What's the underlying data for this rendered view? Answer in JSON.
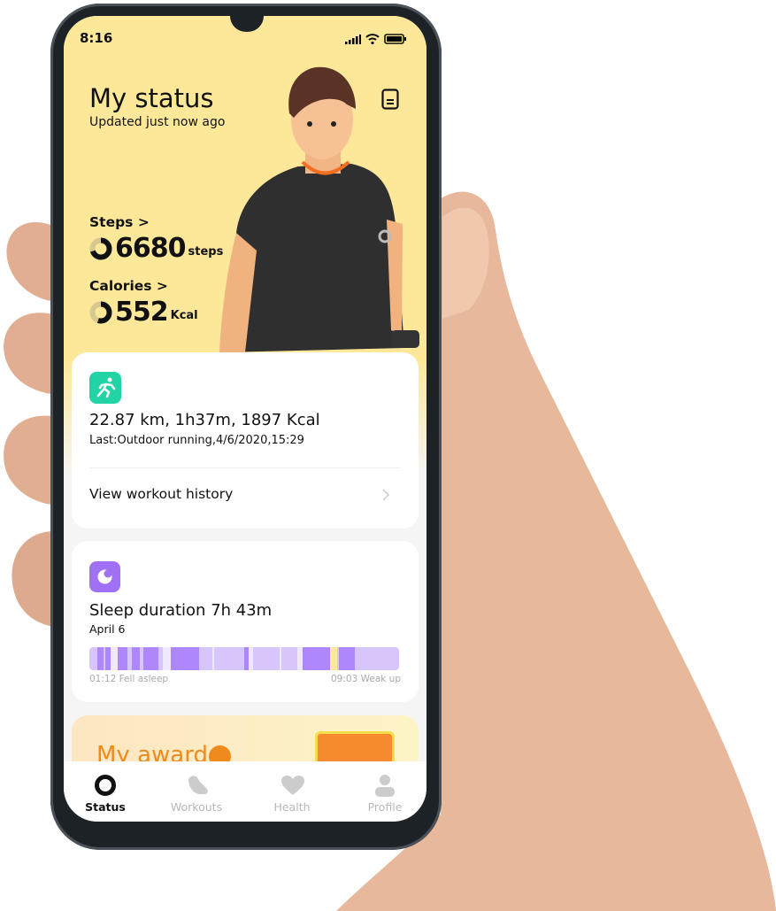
{
  "status_bar": {
    "time": "8:16"
  },
  "header": {
    "title": "My status",
    "subtitle": "Updated just now ago",
    "icon": "document-icon"
  },
  "steps": {
    "label": "Steps",
    "chevron": ">",
    "value": "6680",
    "unit": "steps",
    "progress": 0.7
  },
  "calories": {
    "label": "Calories",
    "chevron": ">",
    "value": "552",
    "unit": "Kcal",
    "progress": 0.55
  },
  "workout_card": {
    "icon": "running-icon",
    "icon_color": "#22d3a6",
    "summary": "22.87 km, 1h37m, 1897 Kcal",
    "last": "Last:Outdoor running,4/6/2020,15:29",
    "history_link": "View workout history"
  },
  "sleep_card": {
    "icon": "moon-icon",
    "icon_color": "#a071f5",
    "title": "Sleep duration 7h 43m",
    "date": "April 6",
    "start_label": "01:12 Fell asleep",
    "end_label": "09:03 Weak up",
    "colors": {
      "deep": "#ad87fb",
      "light": "#d6c6fc",
      "awake": "#efe8fe",
      "rem": "#fde99a"
    },
    "stages": [
      [
        "light",
        27
      ],
      [
        "deep",
        21
      ],
      [
        "light",
        7
      ],
      [
        "deep",
        17
      ],
      [
        "awake",
        23
      ],
      [
        "deep",
        35
      ],
      [
        "light",
        15
      ],
      [
        "deep",
        25
      ],
      [
        "light",
        12
      ],
      [
        "deep",
        53
      ],
      [
        "light",
        15
      ],
      [
        "awake",
        25
      ],
      [
        "deep",
        97
      ],
      [
        "light",
        43
      ],
      [
        "awake",
        8
      ],
      [
        "light",
        100
      ],
      [
        "deep",
        17
      ],
      [
        "awake",
        13
      ],
      [
        "light",
        90
      ],
      [
        "awake",
        8
      ],
      [
        "light",
        54
      ],
      [
        "awake",
        17
      ],
      [
        "deep",
        93
      ],
      [
        "rem",
        23
      ],
      [
        "light",
        7
      ],
      [
        "deep",
        53
      ],
      [
        "light",
        149
      ]
    ]
  },
  "award_card": {
    "title": "My award"
  },
  "nav": {
    "items": [
      {
        "label": "Status",
        "icon": "status-ring-icon",
        "active": true
      },
      {
        "label": "Workouts",
        "icon": "shoe-icon"
      },
      {
        "label": "Health",
        "icon": "heart-icon"
      },
      {
        "label": "Profile",
        "icon": "person-icon"
      }
    ]
  }
}
